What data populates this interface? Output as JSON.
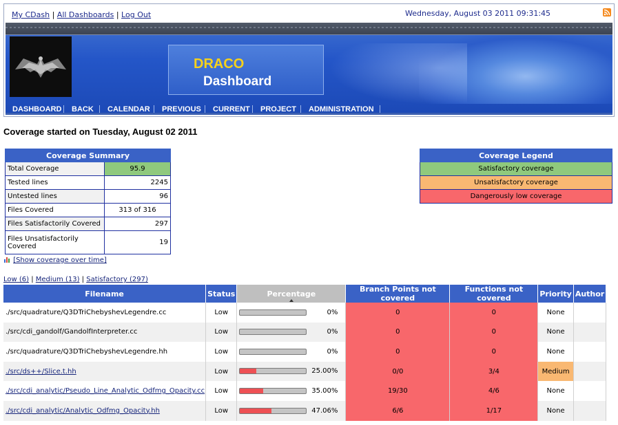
{
  "toplinks": {
    "mycdash": "My CDash",
    "sep1": " | ",
    "all_dashboards": "All Dashboards",
    "sep2": " | ",
    "logout": "Log Out"
  },
  "datetime": "Wednesday, August 03 2011 09:31:45",
  "banner": {
    "project": "DRACO",
    "subtitle": "Dashboard"
  },
  "nav": [
    "DASHBOARD",
    "BACK",
    "CALENDAR",
    "PREVIOUS",
    "CURRENT",
    "PROJECT",
    "ADMINISTRATION"
  ],
  "heading": "Coverage started on Tuesday, August 02 2011",
  "summary": {
    "title": "Coverage Summary",
    "rows": [
      {
        "label": "Total Coverage",
        "value": "95.9"
      },
      {
        "label": "Tested lines",
        "value": "2245"
      },
      {
        "label": "Untested lines",
        "value": "96"
      },
      {
        "label": "Files Covered",
        "value": "313 of 316"
      },
      {
        "label": "Files Satisfactorily Covered",
        "value": "297"
      },
      {
        "label": "Files Unsatisfactorily Covered",
        "value": "19"
      }
    ]
  },
  "legend": {
    "title": "Coverage Legend",
    "items": [
      {
        "label": "Satisfactory coverage",
        "color": "#8fc97d"
      },
      {
        "label": "Unsatisfactory coverage",
        "color": "#f9b872"
      },
      {
        "label": "Dangerously low coverage",
        "color": "#f8676b"
      }
    ]
  },
  "show_coverage_link": "[Show coverage over time]",
  "filters": {
    "low": "Low (6)",
    "sep1": " | ",
    "medium": "Medium (13)",
    "sep2": " | ",
    "satisfactory": "Satisfactory (297)"
  },
  "table": {
    "headers": [
      "Filename",
      "Status",
      "Percentage",
      "Branch Points not covered",
      "Functions not covered",
      "Priority",
      "Author"
    ],
    "rows": [
      {
        "file": "./src/quadrature/Q3DTriChebyshevLegendre.cc",
        "link": false,
        "status": "Low",
        "percent": 0,
        "percent_text": "0%",
        "branch": "0",
        "functions": "0",
        "priority": "None",
        "author": ""
      },
      {
        "file": "./src/cdi_gandolf/GandolfInterpreter.cc",
        "link": false,
        "status": "Low",
        "percent": 0,
        "percent_text": "0%",
        "branch": "0",
        "functions": "0",
        "priority": "None",
        "author": ""
      },
      {
        "file": "./src/quadrature/Q3DTriChebyshevLegendre.hh",
        "link": false,
        "status": "Low",
        "percent": 0,
        "percent_text": "0%",
        "branch": "0",
        "functions": "0",
        "priority": "None",
        "author": ""
      },
      {
        "file": "./src/ds++/Slice.t.hh",
        "link": true,
        "status": "Low",
        "percent": 25,
        "percent_text": "25.00%",
        "branch": "0/0",
        "functions": "3/4",
        "priority": "Medium",
        "author": ""
      },
      {
        "file": "./src/cdi_analytic/Pseudo_Line_Analytic_Odfmg_Opacity.cc",
        "link": true,
        "status": "Low",
        "percent": 35,
        "percent_text": "35.00%",
        "branch": "19/30",
        "functions": "4/6",
        "priority": "None",
        "author": ""
      },
      {
        "file": "./src/cdi_analytic/Analytic_Odfmg_Opacity.hh",
        "link": true,
        "status": "Low",
        "percent": 47.06,
        "percent_text": "47.06%",
        "branch": "6/6",
        "functions": "1/17",
        "priority": "None",
        "author": ""
      }
    ]
  }
}
